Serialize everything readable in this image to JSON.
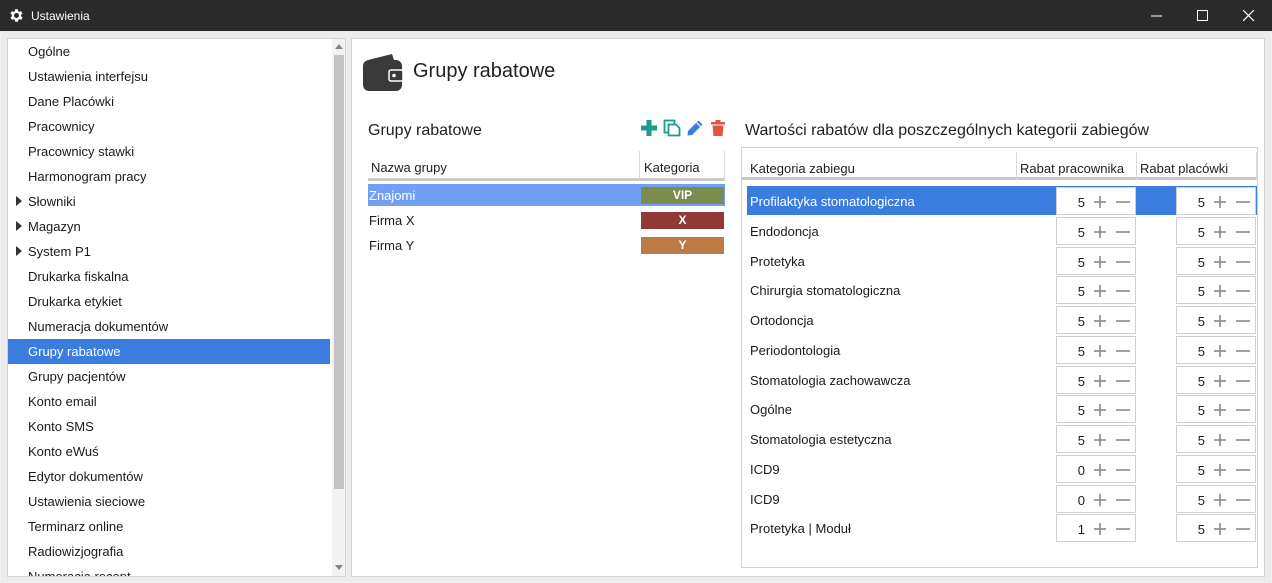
{
  "window": {
    "title": "Ustawienia"
  },
  "sidebar": {
    "items": [
      {
        "label": "Ogólne",
        "expandable": false
      },
      {
        "label": "Ustawienia interfejsu",
        "expandable": false
      },
      {
        "label": "Dane Placówki",
        "expandable": false
      },
      {
        "label": "Pracownicy",
        "expandable": false
      },
      {
        "label": "Pracownicy stawki",
        "expandable": false
      },
      {
        "label": "Harmonogram pracy",
        "expandable": false
      },
      {
        "label": "Słowniki",
        "expandable": true
      },
      {
        "label": "Magazyn",
        "expandable": true
      },
      {
        "label": "System P1",
        "expandable": true
      },
      {
        "label": "Drukarka fiskalna",
        "expandable": false
      },
      {
        "label": "Drukarka etykiet",
        "expandable": false
      },
      {
        "label": "Numeracja dokumentów",
        "expandable": false
      },
      {
        "label": "Grupy rabatowe",
        "expandable": false,
        "selected": true
      },
      {
        "label": "Grupy pacjentów",
        "expandable": false
      },
      {
        "label": "Konto email",
        "expandable": false
      },
      {
        "label": "Konto SMS",
        "expandable": false
      },
      {
        "label": "Konto eWuś",
        "expandable": false
      },
      {
        "label": "Edytor dokumentów",
        "expandable": false
      },
      {
        "label": "Ustawienia sieciowe",
        "expandable": false
      },
      {
        "label": "Terminarz online",
        "expandable": false
      },
      {
        "label": "Radiowizjografia",
        "expandable": false
      },
      {
        "label": "Numeracja recept",
        "expandable": false
      }
    ]
  },
  "main": {
    "page_title": "Grupy rabatowe",
    "groups": {
      "section_title": "Grupy rabatowe",
      "toolbar": [
        "plus-icon",
        "copy-icon",
        "edit-pencil-icon",
        "trash-icon"
      ],
      "columns": {
        "name": "Nazwa grupy",
        "category": "Kategoria"
      },
      "rows": [
        {
          "name": "Znajomi",
          "category": "VIP",
          "color": "#7a8c4e",
          "selected": true
        },
        {
          "name": "Firma X",
          "category": "X",
          "color": "#913a35"
        },
        {
          "name": "Firma Y",
          "category": "Y",
          "color": "#bd7a44"
        }
      ]
    },
    "discounts": {
      "section_title": "Wartości rabatów dla poszczególnych kategorii zabiegów",
      "columns": {
        "category": "Kategoria zabiegu",
        "employee": "Rabat pracownika",
        "clinic": "Rabat placówki"
      },
      "rows": [
        {
          "category": "Profilaktyka stomatologiczna",
          "employee": "5",
          "clinic": "5",
          "selected": true
        },
        {
          "category": "Endodoncja",
          "employee": "5",
          "clinic": "5"
        },
        {
          "category": "Protetyka",
          "employee": "5",
          "clinic": "5"
        },
        {
          "category": "Chirurgia stomatologiczna",
          "employee": "5",
          "clinic": "5"
        },
        {
          "category": "Ortodoncja",
          "employee": "5",
          "clinic": "5"
        },
        {
          "category": "Periodontologia",
          "employee": "5",
          "clinic": "5"
        },
        {
          "category": "Stomatologia zachowawcza",
          "employee": "5",
          "clinic": "5"
        },
        {
          "category": "Ogólne",
          "employee": "5",
          "clinic": "5"
        },
        {
          "category": "Stomatologia estetyczna",
          "employee": "5",
          "clinic": "5"
        },
        {
          "category": "ICD9",
          "employee": "0",
          "clinic": "5"
        },
        {
          "category": "ICD9",
          "employee": "0",
          "clinic": "5"
        },
        {
          "category": "Protetyka | Moduł",
          "employee": "1",
          "clinic": "5"
        }
      ]
    }
  },
  "colors": {
    "accent": "#3a7ddf",
    "selection_light": "#6fa0f2",
    "add_icon": "#1b9b8a",
    "edit_icon": "#3a7ddf",
    "delete_icon": "#e4543c"
  }
}
